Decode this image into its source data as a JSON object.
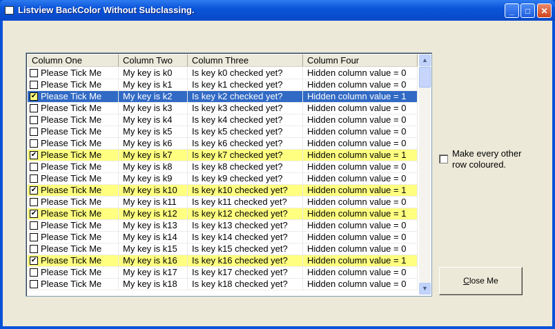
{
  "window": {
    "title": "Listview BackColor Without Subclassing.",
    "minimize": "_",
    "maximize": "□",
    "close": "✕"
  },
  "colors": {
    "highlight": "#FFFF80",
    "selection": "#316AC5"
  },
  "listview": {
    "columns": [
      "Column One",
      "Column Two",
      "Column Three",
      "Column Four"
    ],
    "selected_index": 2,
    "rows": [
      {
        "c1": "Please Tick Me",
        "c2": "My key is k0",
        "c3": "Is key k0 checked yet?",
        "c4": "Hidden column value = 0",
        "checked": false
      },
      {
        "c1": "Please Tick Me",
        "c2": "My key is k1",
        "c3": "Is key k1 checked yet?",
        "c4": "Hidden column value = 0",
        "checked": false
      },
      {
        "c1": "Please Tick Me",
        "c2": "My key is k2",
        "c3": "Is key k2 checked yet?",
        "c4": "Hidden column value = 1",
        "checked": true
      },
      {
        "c1": "Please Tick Me",
        "c2": "My key is k3",
        "c3": "Is key k3 checked yet?",
        "c4": "Hidden column value = 0",
        "checked": false
      },
      {
        "c1": "Please Tick Me",
        "c2": "My key is k4",
        "c3": "Is key k4 checked yet?",
        "c4": "Hidden column value = 0",
        "checked": false
      },
      {
        "c1": "Please Tick Me",
        "c2": "My key is k5",
        "c3": "Is key k5 checked yet?",
        "c4": "Hidden column value = 0",
        "checked": false
      },
      {
        "c1": "Please Tick Me",
        "c2": "My key is k6",
        "c3": "Is key k6 checked yet?",
        "c4": "Hidden column value = 0",
        "checked": false
      },
      {
        "c1": "Please Tick Me",
        "c2": "My key is k7",
        "c3": "Is key k7 checked yet?",
        "c4": "Hidden column value = 1",
        "checked": true
      },
      {
        "c1": "Please Tick Me",
        "c2": "My key is k8",
        "c3": "Is key k8 checked yet?",
        "c4": "Hidden column value = 0",
        "checked": false
      },
      {
        "c1": "Please Tick Me",
        "c2": "My key is k9",
        "c3": "Is key k9 checked yet?",
        "c4": "Hidden column value = 0",
        "checked": false
      },
      {
        "c1": "Please Tick Me",
        "c2": "My key is k10",
        "c3": "Is key k10 checked yet?",
        "c4": "Hidden column value = 1",
        "checked": true
      },
      {
        "c1": "Please Tick Me",
        "c2": "My key is k11",
        "c3": "Is key k11 checked yet?",
        "c4": "Hidden column value = 0",
        "checked": false
      },
      {
        "c1": "Please Tick Me",
        "c2": "My key is k12",
        "c3": "Is key k12 checked yet?",
        "c4": "Hidden column value = 1",
        "checked": true
      },
      {
        "c1": "Please Tick Me",
        "c2": "My key is k13",
        "c3": "Is key k13 checked yet?",
        "c4": "Hidden column value = 0",
        "checked": false
      },
      {
        "c1": "Please Tick Me",
        "c2": "My key is k14",
        "c3": "Is key k14 checked yet?",
        "c4": "Hidden column value = 0",
        "checked": false
      },
      {
        "c1": "Please Tick Me",
        "c2": "My key is k15",
        "c3": "Is key k15 checked yet?",
        "c4": "Hidden column value = 0",
        "checked": false
      },
      {
        "c1": "Please Tick Me",
        "c2": "My key is k16",
        "c3": "Is key k16 checked yet?",
        "c4": "Hidden column value = 1",
        "checked": true
      },
      {
        "c1": "Please Tick Me",
        "c2": "My key is k17",
        "c3": "Is key k17 checked yet?",
        "c4": "Hidden column value = 0",
        "checked": false
      },
      {
        "c1": "Please Tick Me",
        "c2": "My key is k18",
        "c3": "Is key k18 checked yet?",
        "c4": "Hidden column value = 0",
        "checked": false
      }
    ]
  },
  "option": {
    "label": "Make every other row coloured.",
    "checked": false
  },
  "close_button": {
    "accel": "C",
    "rest": "lose Me"
  }
}
